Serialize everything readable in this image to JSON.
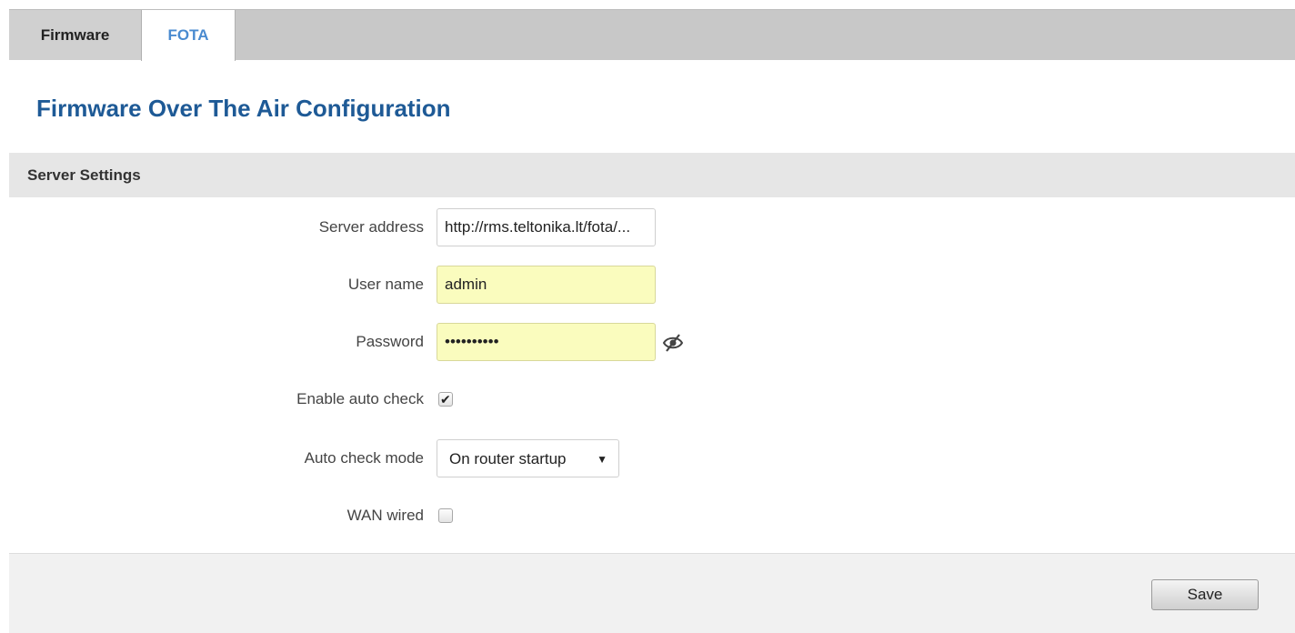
{
  "tabs": [
    {
      "label": "Firmware",
      "active": false
    },
    {
      "label": "FOTA",
      "active": true
    }
  ],
  "page_title": "Firmware Over The Air Configuration",
  "section": {
    "title": "Server Settings"
  },
  "fields": {
    "server_address": {
      "label": "Server address",
      "value": "http://rms.teltonika.lt/fota/..."
    },
    "user_name": {
      "label": "User name",
      "value": "admin"
    },
    "password": {
      "label": "Password",
      "value": "••••••••••",
      "toggle_icon": "eye-slash-icon"
    },
    "enable_auto_check": {
      "label": "Enable auto check",
      "checked": true,
      "check_glyph": "✔"
    },
    "auto_check_mode": {
      "label": "Auto check mode",
      "selected": "On router startup",
      "arrow": "▼"
    },
    "wan_wired": {
      "label": "WAN wired",
      "checked": false
    }
  },
  "footer": {
    "save_label": "Save"
  },
  "colors": {
    "title": "#1e5a96",
    "active_tab": "#4a8bd0",
    "autofill_bg": "#fafcbe",
    "tabbar_bg": "#c8c8c8",
    "section_bg": "#e6e6e6",
    "footer_bg": "#f1f1f1"
  }
}
